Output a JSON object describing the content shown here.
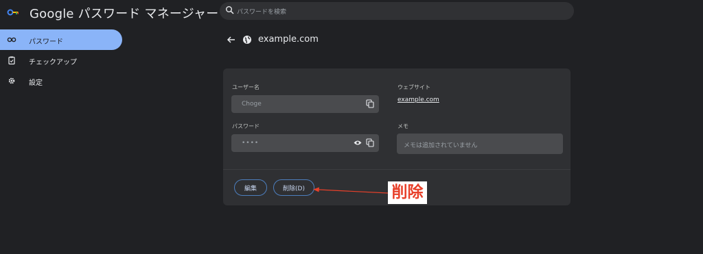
{
  "header": {
    "app_title": "Google パスワード マネージャー",
    "logo": "key-logo-icon"
  },
  "search": {
    "placeholder": "パスワードを検索",
    "icon": "search-icon"
  },
  "sidebar": {
    "items": [
      {
        "label": "パスワード",
        "icon": "key-icon",
        "active": true
      },
      {
        "label": "チェックアップ",
        "icon": "clipboard-check-icon",
        "active": false
      },
      {
        "label": "設定",
        "icon": "gear-icon",
        "active": false
      }
    ]
  },
  "detail": {
    "site_title": "example.com",
    "username_label": "ユーザー名",
    "username_value": "Choge",
    "password_label": "パスワード",
    "password_value": "••••",
    "website_label": "ウェブサイト",
    "website_value": "example.com",
    "memo_label": "メモ",
    "memo_placeholder": "メモは追加されていません",
    "edit_button": "編集",
    "delete_button": "削除(D)"
  },
  "annotation": {
    "label": "削除",
    "color": "#e8402a"
  },
  "colors": {
    "background": "#202124",
    "accent": "#8ab4f8",
    "card": "#2f3033"
  }
}
